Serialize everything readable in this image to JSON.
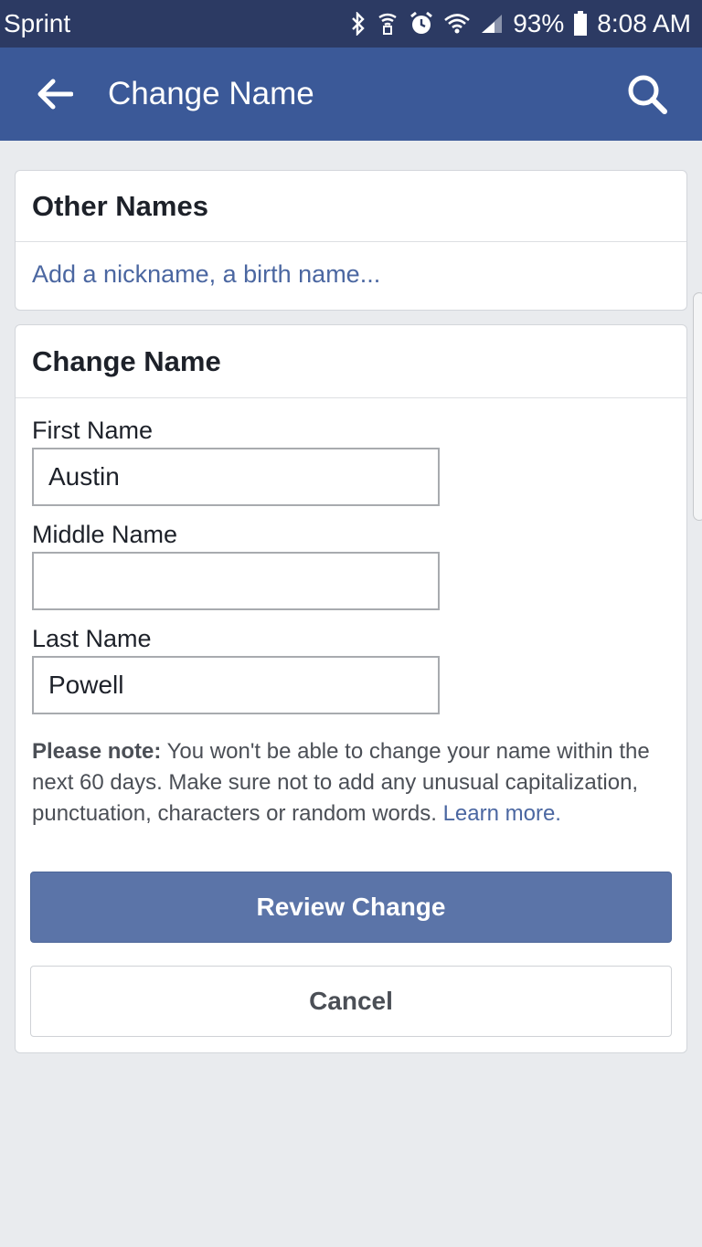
{
  "status_bar": {
    "carrier": "Sprint",
    "battery": "93%",
    "time": "8:08 AM",
    "icons": [
      "bluetooth-icon",
      "nfc-icon",
      "alarm-icon",
      "wifi-icon",
      "signal-icon",
      "battery-icon"
    ]
  },
  "app_bar": {
    "title": "Change Name",
    "back_icon": "arrow-left-icon",
    "search_icon": "search-icon"
  },
  "other_names": {
    "header": "Other Names",
    "link": "Add a nickname, a birth name..."
  },
  "change_name": {
    "header": "Change Name",
    "first_name_label": "First Name",
    "first_name_value": "Austin",
    "middle_name_label": "Middle Name",
    "middle_name_value": "",
    "last_name_label": "Last Name",
    "last_name_value": "Powell",
    "note_bold": "Please note:",
    "note_text": " You won't be able to change your name within the next 60 days. Make sure not to add any unusual capitalization, punctuation, characters or random words. ",
    "learn_more": "Learn more.",
    "review_button": "Review Change",
    "cancel_button": "Cancel"
  },
  "colors": {
    "status_bar": "#2c3a63",
    "app_bar": "#3b5998",
    "link": "#4b67a1",
    "primary_button": "#5b74a8",
    "background": "#e9ebee"
  }
}
